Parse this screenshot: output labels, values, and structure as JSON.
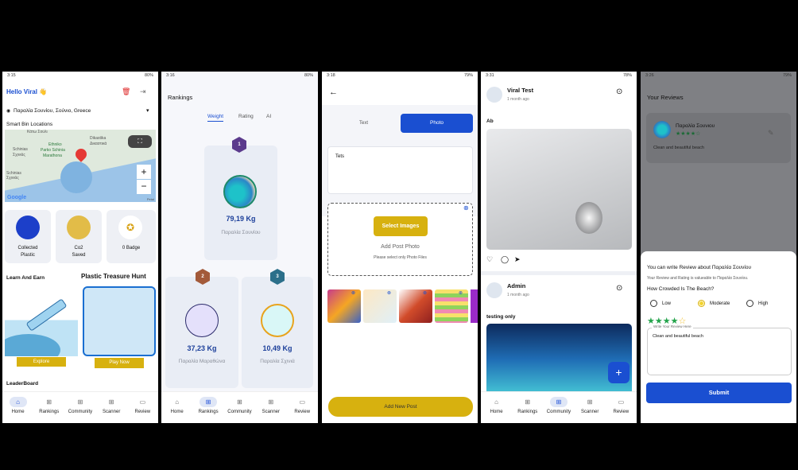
{
  "screens": {
    "home": {
      "time": "3:15",
      "battery": "80%",
      "greeting": "Hello Viral 👋",
      "location": "Παραλία Σουνίου, Σούνιο, Greece",
      "section_title": "Smart Bin Locations",
      "map_labels": {
        "l1": "Κάτω Σούλι",
        "l2": "Dikastika",
        "l3": "Δικαστικά",
        "l4": "Schinias",
        "l5": "Σχινιάς",
        "l6": "Ethniko",
        "l7": "Parko Schinia",
        "l8": "Marathona",
        "l9": "Schinias",
        "l10": "Σχινιάς",
        "google": "Google",
        "petal": "Petal"
      },
      "stats": [
        {
          "label": "Collected Plastic"
        },
        {
          "label": "Co2 Saved"
        },
        {
          "label": "0 Badge"
        }
      ],
      "learn_title": "Learn And Earn",
      "explore": "Explore",
      "hunt_title": "Plastic Treasure Hunt",
      "play": "Play Now",
      "leaderboard": "LeaderBoard"
    },
    "rankings": {
      "time": "3:16",
      "battery": "80%",
      "title": "Rankings",
      "tabs": [
        "Weight",
        "Rating",
        "AI"
      ],
      "first": {
        "rank": "1",
        "value": "79,19 Kg",
        "name": "Παραλία Σουνίου"
      },
      "second": {
        "rank": "2",
        "value": "37,23 Kg",
        "name": "Παραλία Μαραθώνα"
      },
      "third": {
        "rank": "3",
        "value": "10,49 Kg",
        "name": "Παραλία Σχινιά"
      }
    },
    "post": {
      "time": "3:18",
      "battery": "79%",
      "back": "←",
      "tab_text": "Text",
      "tab_photo": "Photo",
      "text_value": "Tets",
      "select_images": "Select Images",
      "add_post_photo": "Add Post Photo",
      "hint": "Please select only Photo Files",
      "submit": "Add New Post"
    },
    "community": {
      "time": "3:31",
      "battery": "78%",
      "post1": {
        "user": "Viral Test",
        "time": "1 month ago",
        "caption": "Ab"
      },
      "post2": {
        "user": "Admin",
        "time": "1 month ago",
        "caption": "testing only"
      },
      "fab": "+"
    },
    "review": {
      "time": "3:26",
      "battery": "79%",
      "title": "Your Reviews",
      "beach": "Παραλία Σουνιου",
      "stars": 4,
      "review_text": "Clean and beautiful beach",
      "sheet_title": "You can write Review about Παραλία Σουνίου",
      "sheet_sub": "Your Review and Rating is valueable to Παραλία Σουνίου.",
      "question": "How Crowded Is The Beach?",
      "options": [
        "Low",
        "Moderate",
        "High"
      ],
      "selected": "Moderate",
      "rating": 4,
      "field_label": "Write Your Review Here",
      "field_value": "Clean and beautiful beach",
      "submit": "Submit"
    }
  },
  "nav": [
    "Home",
    "Rankings",
    "Community",
    "Scanner",
    "Review"
  ],
  "colors": {
    "primary": "#1a4fd1",
    "gold": "#d7b10f",
    "green": "#22a34a"
  }
}
